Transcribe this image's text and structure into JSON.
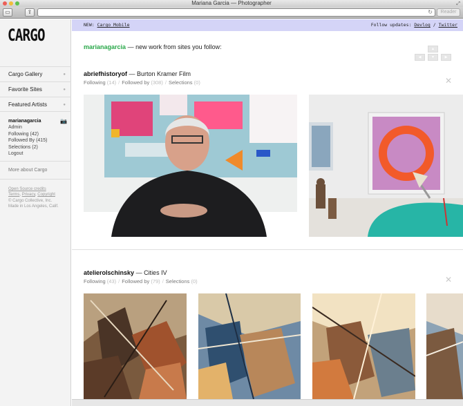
{
  "window": {
    "title": "Mariana Garcia — Photographer"
  },
  "browser": {
    "reader_label": "Reader"
  },
  "sidebar": {
    "logo": "CARGO",
    "nav": [
      {
        "label": "Cargo Gallery"
      },
      {
        "label": "Favorite Sites"
      },
      {
        "label": "Featured Artists"
      }
    ],
    "user": {
      "name": "marianagarcia",
      "links": [
        "Admin",
        "Following (42)",
        "Followed By (415)",
        "Selections (2)",
        "Logout"
      ]
    },
    "more_about": "More about Cargo",
    "footer": {
      "open_source": "Open Source credits",
      "terms": "Terms",
      "privacy": "Privacy",
      "copyright": "Copyright",
      "company": "© Cargo Collective, Inc.",
      "made_in": "Made in Los Angeles, Calif."
    }
  },
  "notice": {
    "new_label": "NEW:",
    "new_link": "Cargo Mobile",
    "follow_label": "Follow updates:",
    "devlog": "Devlog",
    "slash": "/",
    "twitter": "Twitter"
  },
  "feed": {
    "user": "marianagarcia",
    "heading_rest": "— new work from sites you follow:"
  },
  "sections": [
    {
      "site": "abriefhistoryof",
      "project": "— Burton Kramer Film",
      "following_label": "Following",
      "following_count": "(14)",
      "followed_label": "Followed by",
      "followed_count": "(308)",
      "selections_label": "Selections",
      "selections_count": "(0)"
    },
    {
      "site": "atelierolschinsky",
      "project": "— Cities IV",
      "following_label": "Following",
      "following_count": "(43)",
      "followed_label": "Followed by",
      "followed_count": "(79)",
      "selections_label": "Selections",
      "selections_count": "(0)"
    }
  ],
  "colors": {
    "accent_green": "#2aa84a",
    "notice_bg": "#d4d4f7"
  }
}
